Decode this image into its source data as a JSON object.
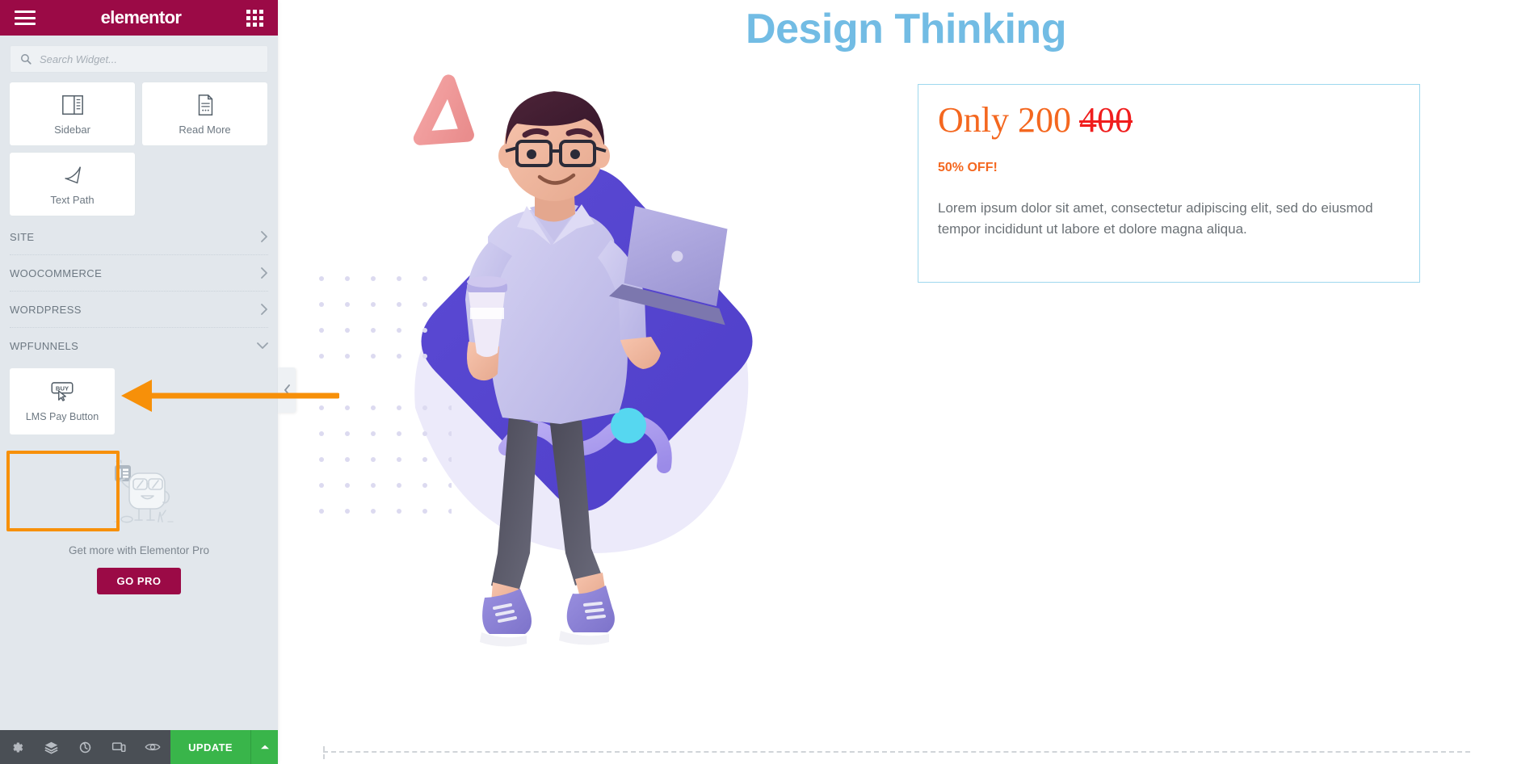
{
  "panel": {
    "header": {
      "menu_icon": "hamburger-icon",
      "brand": "elementor",
      "apps_icon": "grid-apps-icon"
    },
    "search": {
      "placeholder": "Search Widget...",
      "value": "",
      "icon": "search-icon"
    },
    "widgets": [
      {
        "label": "Sidebar",
        "icon": "sidebar-layout-icon"
      },
      {
        "label": "Read More",
        "icon": "document-read-more-icon"
      },
      {
        "label": "Text Path",
        "icon": "text-path-icon"
      }
    ],
    "categories": [
      {
        "label": "SITE",
        "expanded": false,
        "icon": "chevron-right-icon"
      },
      {
        "label": "WOOCOMMERCE",
        "expanded": false,
        "icon": "chevron-right-icon"
      },
      {
        "label": "WORDPRESS",
        "expanded": false,
        "icon": "chevron-right-icon"
      },
      {
        "label": "WPFUNNELS",
        "expanded": true,
        "icon": "chevron-down-icon"
      }
    ],
    "wpfunnels_widgets": [
      {
        "label": "LMS Pay Button",
        "icon": "buy-button-cursor-icon",
        "highlighted": true
      }
    ],
    "promo": {
      "illustration": "elementor-mascot-icon",
      "text": "Get more with Elementor Pro",
      "button_label": "GO PRO"
    },
    "footer": {
      "buttons": [
        {
          "name": "settings",
          "icon": "gear-icon"
        },
        {
          "name": "navigator",
          "icon": "layers-icon"
        },
        {
          "name": "history",
          "icon": "history-clock-icon"
        },
        {
          "name": "responsive-mode",
          "icon": "device-responsive-icon"
        },
        {
          "name": "preview",
          "icon": "eye-preview-icon"
        }
      ],
      "update_label": "UPDATE",
      "update_caret_icon": "chevron-up-icon"
    },
    "collapse_handle_icon": "chevron-left-icon"
  },
  "canvas": {
    "heading": "Design Thinking",
    "illustration": "3d-man-with-laptop-and-coffee",
    "price_box": {
      "price_now": "Only 200",
      "price_old": "400",
      "discount": "50% OFF!",
      "body": "Lorem ipsum dolor sit amet, consectetur adipiscing elit, sed do eiusmod tempor incididunt ut labore et dolore magna aliqua."
    }
  },
  "annotation": {
    "arrow": "orange-arrow-pointing-left",
    "highlight": "orange-highlight-box"
  },
  "colors": {
    "brand": "#9b0a46",
    "accent_orange": "#f79009",
    "heading_blue": "#72bce4",
    "price_orange": "#f4671f",
    "price_red": "#f01e1e",
    "update_green": "#39b54a",
    "panel_bg": "#e2e7ec",
    "footer_bg": "#4a4f55"
  }
}
